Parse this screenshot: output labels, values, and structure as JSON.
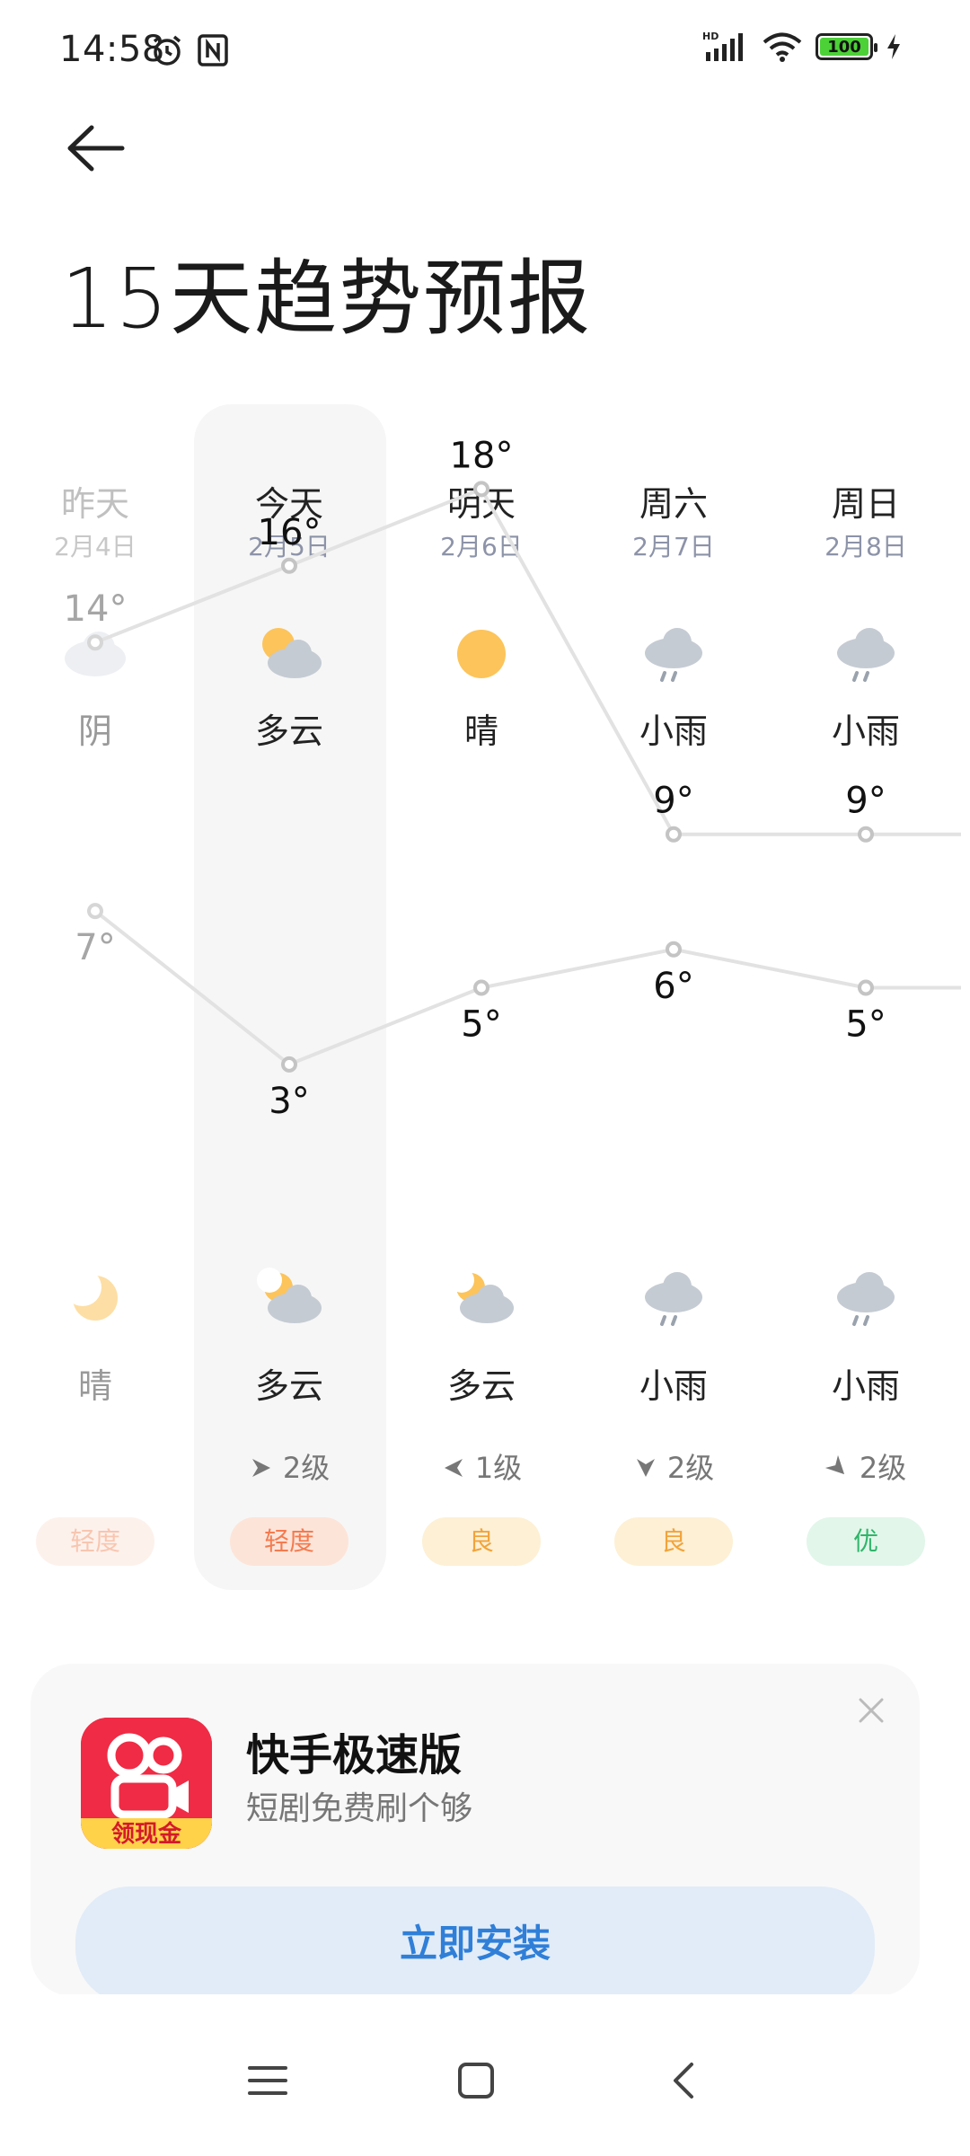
{
  "status_bar": {
    "time": "14:58",
    "battery": "100",
    "network": "HD"
  },
  "page": {
    "title": "15天趋势预报"
  },
  "days": [
    {
      "name": "昨天",
      "date": "2月4日",
      "day_cond": "阴",
      "high": "14°",
      "low": "7°",
      "night_cond": "晴",
      "wind": "",
      "aqi": "轻度",
      "day_icon": "overcast-icon",
      "night_icon": "moon-icon"
    },
    {
      "name": "今天",
      "date": "2月5日",
      "day_cond": "多云",
      "high": "16°",
      "low": "3°",
      "night_cond": "多云",
      "wind": "2级",
      "aqi": "轻度",
      "day_icon": "partly-cloudy-icon",
      "night_icon": "cloudy-night-icon"
    },
    {
      "name": "明天",
      "date": "2月6日",
      "day_cond": "晴",
      "high": "18°",
      "low": "5°",
      "night_cond": "多云",
      "wind": "1级",
      "aqi": "良",
      "day_icon": "sun-icon",
      "night_icon": "cloudy-night-icon"
    },
    {
      "name": "周六",
      "date": "2月7日",
      "day_cond": "小雨",
      "high": "9°",
      "low": "6°",
      "night_cond": "小雨",
      "wind": "2级",
      "aqi": "良",
      "day_icon": "light-rain-icon",
      "night_icon": "light-rain-icon"
    },
    {
      "name": "周日",
      "date": "2月8日",
      "day_cond": "小雨",
      "high": "9°",
      "low": "5°",
      "night_cond": "小雨",
      "wind": "2级",
      "aqi": "优",
      "day_icon": "light-rain-icon",
      "night_icon": "light-rain-icon"
    }
  ],
  "chart_data": {
    "type": "line",
    "categories": [
      "昨天",
      "今天",
      "明天",
      "周六",
      "周日"
    ],
    "series": [
      {
        "values": [
          14,
          16,
          18,
          9,
          9
        ]
      },
      {
        "values": [
          7,
          3,
          5,
          6,
          5
        ]
      }
    ]
  },
  "ad": {
    "app_name": "快手极速版",
    "subtitle": "短剧免费刷个够",
    "icon_badge": "领现金",
    "button": "立即安装"
  },
  "colors": {
    "aqi_light": "#f47b4f",
    "aqi_good": "#f2a33a",
    "aqi_excellent": "#2fb56a",
    "accent": "#2f7fd8"
  }
}
